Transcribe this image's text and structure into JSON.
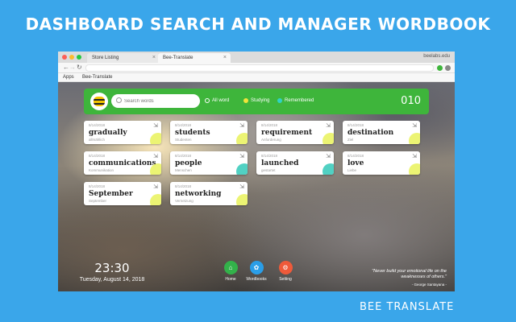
{
  "promo": {
    "title": "DASHBOARD SEARCH AND MANAGER WORDBOOK",
    "brand": "BEE TRANSLATE"
  },
  "browser": {
    "tabs": [
      {
        "label": "Store Listing",
        "close": "×"
      },
      {
        "label": "Bee-Translate",
        "close": "×"
      }
    ],
    "profile": "beelabs.edu",
    "bookmarks": {
      "apps": "Apps",
      "bee": "Bee-Translate"
    }
  },
  "app": {
    "search_placeholder": "Search words",
    "filters": [
      {
        "label": "All word",
        "color": "#ffffff"
      },
      {
        "label": "Studying",
        "color": "#f1e43a"
      },
      {
        "label": "Remembered",
        "color": "#2fd3c4"
      }
    ],
    "count": "010",
    "cards": [
      {
        "date": "8/14/2018",
        "word": "gradually",
        "translation": "allmählich",
        "accent": "#e9f25a"
      },
      {
        "date": "8/14/2018",
        "word": "students",
        "translation": "Studenten",
        "accent": "#e9f25a"
      },
      {
        "date": "8/14/2018",
        "word": "requirement",
        "translation": "Anforderung",
        "accent": "#e9f25a"
      },
      {
        "date": "8/14/2018",
        "word": "destination",
        "translation": "Ziel",
        "accent": "#e9f25a"
      },
      {
        "date": "8/14/2018",
        "word": "communications",
        "translation": "Kommunikation",
        "accent": "#e9f25a"
      },
      {
        "date": "8/14/2018",
        "word": "people",
        "translation": "Menschen",
        "accent": "#32c9b8"
      },
      {
        "date": "8/14/2018",
        "word": "launched",
        "translation": "gestartet",
        "accent": "#32c9b8"
      },
      {
        "date": "8/14/2018",
        "word": "love",
        "translation": "Liebe",
        "accent": "#e9f25a"
      },
      {
        "date": "8/14/2018",
        "word": "September",
        "translation": "September",
        "accent": "#e9f25a"
      },
      {
        "date": "8/14/2018",
        "word": "networking",
        "translation": "Vernetzung",
        "accent": "#e9f25a"
      }
    ],
    "clock": {
      "time": "23:30",
      "date": "Tuesday, August 14, 2018"
    },
    "nav": [
      {
        "label": "Home",
        "icon": "home-icon",
        "color": "#33b24a",
        "glyph": "⌂"
      },
      {
        "label": "Wordbooks",
        "icon": "wordbooks-icon",
        "color": "#2a9ee8",
        "glyph": "✿"
      },
      {
        "label": "Setting",
        "icon": "settings-icon",
        "color": "#ef5a3a",
        "glyph": "⚙"
      }
    ],
    "quote": {
      "text": "\"Never build your emotional life on the weaknesses of others.\"",
      "author": "- George Santayana -"
    }
  }
}
